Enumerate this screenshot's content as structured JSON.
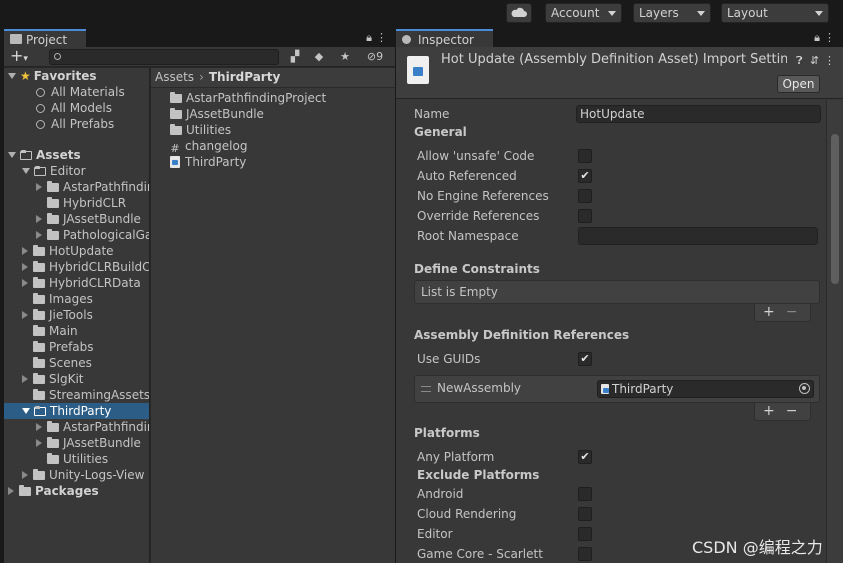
{
  "toolbar": {
    "cloud_icon": "cloud-icon",
    "account_label": "Account",
    "layers_label": "Layers",
    "layout_label": "Layout"
  },
  "project": {
    "tab_label": "Project",
    "search": {
      "value": "",
      "placeholder": ""
    },
    "hidden_count": "9",
    "tree": {
      "favorites": {
        "label": "Favorites",
        "items": [
          "All Materials",
          "All Models",
          "All Prefabs"
        ]
      },
      "assets": {
        "label": "Assets",
        "editor": {
          "label": "Editor",
          "children": [
            "AstarPathfindin",
            "HybridCLR",
            "JAssetBundle",
            "PathologicalGa"
          ]
        },
        "folders": [
          "HotUpdate",
          "HybridCLRBuildC",
          "HybridCLRData",
          "Images",
          "JieTools",
          "Main",
          "Prefabs",
          "Scenes",
          "SlgKit",
          "StreamingAssets"
        ],
        "thirdparty": {
          "label": "ThirdParty",
          "children": [
            "AstarPathfindin",
            "JAssetBundle",
            "Utilities"
          ]
        },
        "after": [
          "Unity-Logs-View"
        ]
      },
      "packages": {
        "label": "Packages"
      }
    },
    "breadcrumb": {
      "root": "Assets",
      "current": "ThirdParty"
    },
    "files": [
      {
        "name": "AstarPathfindingProject",
        "icon": "folder-icon"
      },
      {
        "name": "JAssetBundle",
        "icon": "folder-icon"
      },
      {
        "name": "Utilities",
        "icon": "folder-icon"
      },
      {
        "name": "changelog",
        "icon": "script-hash-icon"
      },
      {
        "name": "ThirdParty",
        "icon": "assembly-definition-icon"
      }
    ]
  },
  "inspector": {
    "tab_label": "Inspector",
    "title": "Hot Update (Assembly Definition Asset) Import Settings",
    "open_label": "Open",
    "name_label": "Name",
    "name_value": "HotUpdate",
    "general": {
      "heading": "General",
      "allow_unsafe": {
        "label": "Allow 'unsafe' Code",
        "checked": false
      },
      "auto_referenced": {
        "label": "Auto Referenced",
        "checked": true
      },
      "no_engine_refs": {
        "label": "No Engine References",
        "checked": false
      },
      "override_refs": {
        "label": "Override References",
        "checked": false
      },
      "root_namespace": {
        "label": "Root Namespace",
        "value": ""
      }
    },
    "define_constraints": {
      "heading": "Define Constraints",
      "empty_text": "List is Empty"
    },
    "assembly_refs": {
      "heading": "Assembly Definition References",
      "use_guids": {
        "label": "Use GUIDs",
        "checked": true
      },
      "items": [
        {
          "label": "NewAssembly",
          "value": "ThirdParty"
        }
      ]
    },
    "platforms": {
      "heading": "Platforms",
      "any_platform": {
        "label": "Any Platform",
        "checked": true
      },
      "exclude_heading": "Exclude Platforms",
      "exclude": [
        {
          "label": "Android",
          "checked": false
        },
        {
          "label": "Cloud Rendering",
          "checked": false
        },
        {
          "label": "Editor",
          "checked": false
        },
        {
          "label": "Game Core - Scarlett",
          "checked": false
        }
      ]
    },
    "plus_minus": "+ −"
  },
  "watermark": "CSDN @编程之力",
  "colors": {
    "background": "#191919",
    "panel": "#383838",
    "selection": "#2c5d87",
    "accent_blue": "#3a80c9",
    "favorite_star": "#f0c23c"
  }
}
